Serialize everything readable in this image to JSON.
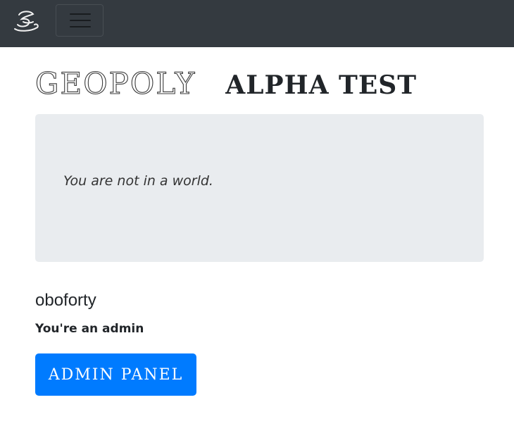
{
  "navbar": {
    "logo_icon": "geopoly-hat-logo-icon",
    "toggler_icon": "hamburger-menu-icon",
    "background": "#343a40"
  },
  "heading": {
    "title": "GEOPOLY",
    "subtitle": "ALPHA TEST"
  },
  "jumbotron": {
    "status": "You are not in a world."
  },
  "user": {
    "name": "oboforty",
    "role_note": "You're an admin"
  },
  "actions": {
    "admin_panel_label": "ADMIN PANEL",
    "accent": "#007bff"
  }
}
